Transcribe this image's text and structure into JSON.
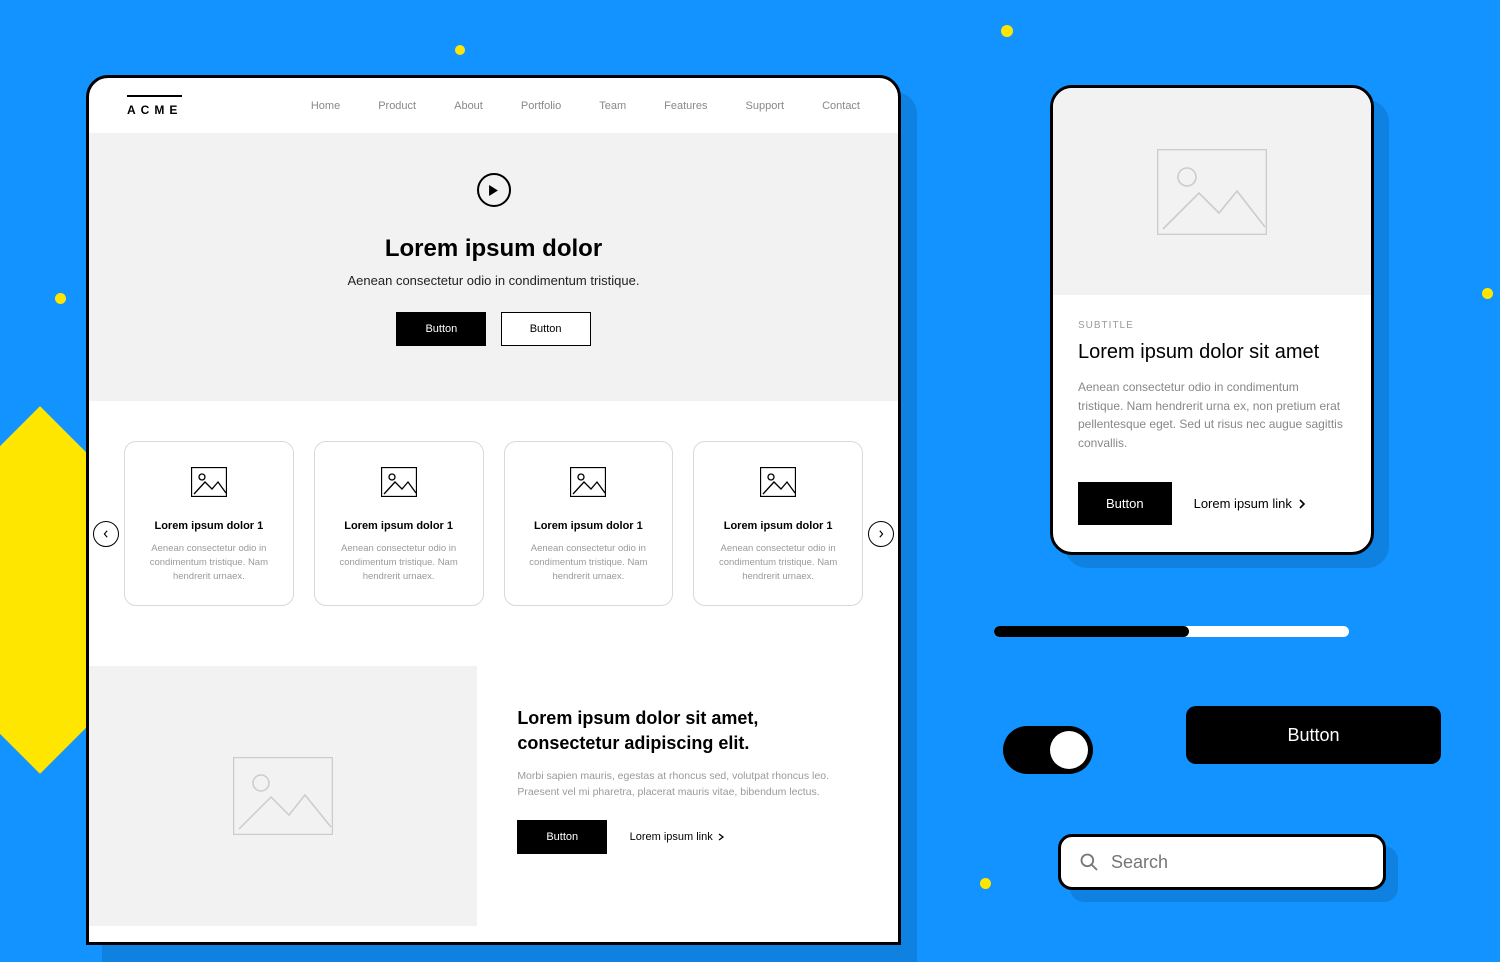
{
  "nav": {
    "logo": "ACME",
    "items": [
      "Home",
      "Product",
      "About",
      "Portfolio",
      "Team",
      "Features",
      "Support",
      "Contact"
    ]
  },
  "hero": {
    "title": "Lorem ipsum dolor",
    "subtitle": "Aenean consectetur odio in condimentum tristique.",
    "btn_primary": "Button",
    "btn_secondary": "Button"
  },
  "cards": [
    {
      "title": "Lorem ipsum dolor 1",
      "body": "Aenean consectetur odio in condimentum tristique. Nam hendrerit urnaex."
    },
    {
      "title": "Lorem ipsum dolor 1",
      "body": "Aenean consectetur odio in condimentum tristique. Nam hendrerit urnaex."
    },
    {
      "title": "Lorem ipsum dolor 1",
      "body": "Aenean consectetur odio in condimentum tristique. Nam hendrerit urnaex."
    },
    {
      "title": "Lorem ipsum dolor 1",
      "body": "Aenean consectetur odio in condimentum tristique. Nam hendrerit urnaex."
    }
  ],
  "split": {
    "title": "Lorem ipsum dolor sit amet, consectetur adipiscing elit.",
    "body": "Morbi sapien mauris, egestas at rhoncus sed, volutpat rhoncus leo. Praesent vel mi pharetra, placerat mauris vitae, bibendum lectus.",
    "btn": "Button",
    "link": "Lorem ipsum link"
  },
  "mobile": {
    "subtitle": "SUBTITLE",
    "title": "Lorem ipsum dolor sit amet",
    "body": "Aenean consectetur odio in condimentum tristique. Nam hendrerit urna ex, non pretium erat pellentesque eget. Sed ut risus nec augue sagittis convallis.",
    "btn": "Button",
    "link": "Lorem ipsum link"
  },
  "progress": {
    "percent": 55
  },
  "big_button": "Button",
  "search": {
    "placeholder": "Search"
  }
}
